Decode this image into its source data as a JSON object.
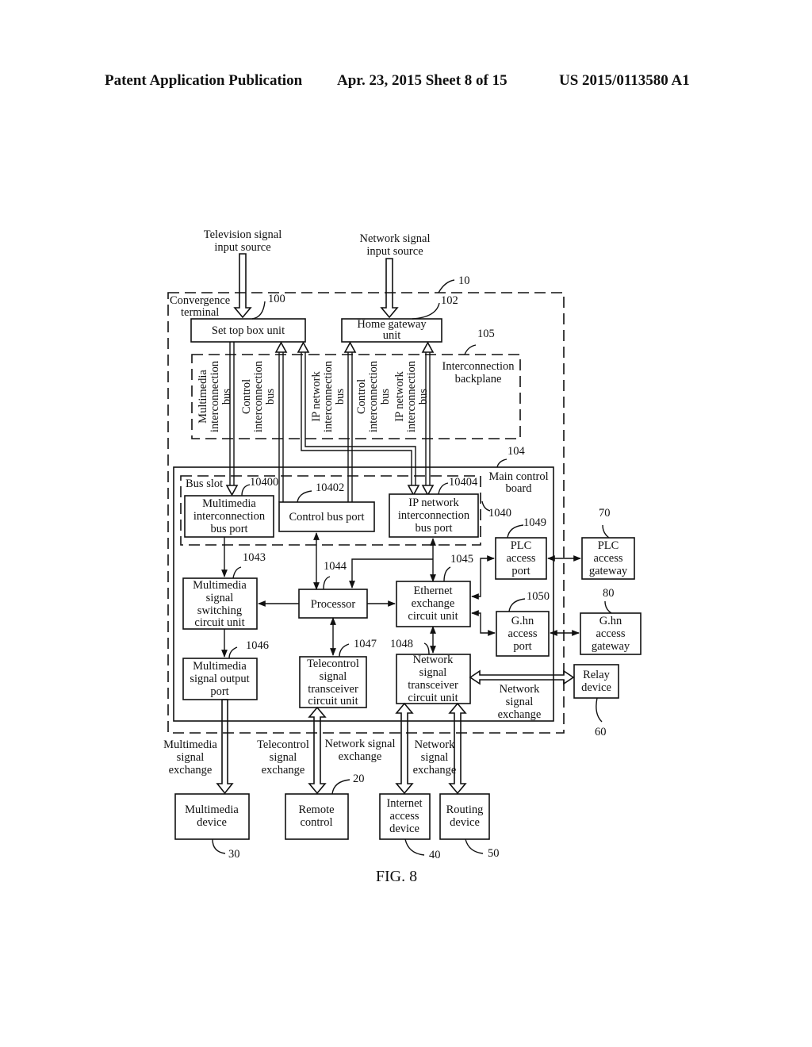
{
  "header": {
    "left": "Patent Application Publication",
    "center": "Apr. 23, 2015  Sheet 8 of 15",
    "right": "US 2015/0113580 A1"
  },
  "inputs": {
    "tv": [
      "Television signal",
      "input source"
    ],
    "net": [
      "Network signal",
      "input source"
    ]
  },
  "terminal": {
    "label": [
      "Convergence",
      "terminal"
    ],
    "ref": "10"
  },
  "stb": {
    "label": "Set top box unit",
    "ref": "100"
  },
  "hgw": {
    "label": [
      "Home gateway",
      "unit"
    ],
    "ref": "102"
  },
  "backplane": {
    "label": [
      "Interconnection",
      "backplane"
    ],
    "ref": "105",
    "buses": [
      [
        "Multimedia",
        "interconnection",
        "bus"
      ],
      [
        "Control",
        "interconnection",
        "bus"
      ],
      [
        "IP network",
        "interconnection",
        "bus"
      ],
      [
        "Control",
        "interconnection",
        "bus"
      ],
      [
        "IP network",
        "interconnection",
        "bus"
      ]
    ]
  },
  "main_board": {
    "label": [
      "Main control",
      "board"
    ],
    "ref": "104"
  },
  "bus_slot": {
    "label": "Bus slot",
    "ref": "1040"
  },
  "mm_port": {
    "label": [
      "Multimedia",
      "interconnection",
      "bus port"
    ],
    "ref": "10400"
  },
  "ctl_port": {
    "label": "Control bus port",
    "ref": "10402"
  },
  "ip_port": {
    "label": [
      "IP network",
      "interconnection",
      "bus port"
    ],
    "ref": "10404"
  },
  "mm_switch": {
    "label": [
      "Multimedia",
      "signal",
      "switching",
      "circuit unit"
    ],
    "ref": "1043"
  },
  "processor": {
    "label": "Processor",
    "ref": "1044"
  },
  "ethernet": {
    "label": [
      "Ethernet",
      "exchange",
      "circuit unit"
    ],
    "ref": "1045"
  },
  "mm_out": {
    "label": [
      "Multimedia",
      "signal output",
      "port"
    ],
    "ref": "1046"
  },
  "telecontrol": {
    "label": [
      "Telecontrol",
      "signal",
      "transceiver",
      "circuit unit"
    ],
    "ref": "1047"
  },
  "net_trx": {
    "label": [
      "Network",
      "signal",
      "transceiver",
      "circuit unit"
    ],
    "ref": "1048"
  },
  "plc_port": {
    "label": [
      "PLC",
      "access",
      "port"
    ],
    "ref": "1049"
  },
  "ghn_port": {
    "label": [
      "G.hn",
      "access",
      "port"
    ],
    "ref": "1050"
  },
  "plc_gw": {
    "label": [
      "PLC",
      "access",
      "gateway"
    ],
    "ref": "70"
  },
  "ghn_gw": {
    "label": [
      "G.hn",
      "access",
      "gateway"
    ],
    "ref": "80"
  },
  "relay": {
    "label": [
      "Relay",
      "device"
    ],
    "ref": "60"
  },
  "relay_link": [
    "Network",
    "signal",
    "exchange"
  ],
  "ext_labels": {
    "mm": [
      "Multimedia",
      "signal",
      "exchange"
    ],
    "tc": [
      "Telecontrol",
      "signal",
      "exchange"
    ],
    "net1": [
      "Network signal",
      "exchange"
    ],
    "net2": [
      "Network",
      "signal",
      "exchange"
    ]
  },
  "mm_device": {
    "label": [
      "Multimedia",
      "device"
    ],
    "ref": "30"
  },
  "remote": {
    "label": [
      "Remote",
      "control"
    ],
    "ref": "20"
  },
  "internet": {
    "label": [
      "Internet",
      "access",
      "device"
    ],
    "ref": "40"
  },
  "routing": {
    "label": [
      "Routing",
      "device"
    ],
    "ref": "50"
  },
  "figure": "FIG. 8"
}
